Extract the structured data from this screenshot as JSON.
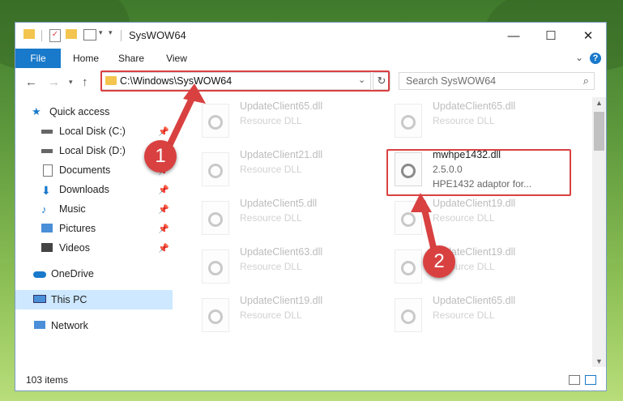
{
  "window": {
    "title": "SysWOW64"
  },
  "ribbon": {
    "tabs": [
      "File",
      "Home",
      "Share",
      "View"
    ]
  },
  "nav": {
    "address": "C:\\Windows\\SysWOW64",
    "search_placeholder": "Search SysWOW64"
  },
  "sidebar": {
    "items": [
      {
        "label": "Quick access",
        "icon": "star-icon"
      },
      {
        "label": "Local Disk (C:)",
        "icon": "drive-icon"
      },
      {
        "label": "Local Disk (D:)",
        "icon": "drive-icon"
      },
      {
        "label": "Documents",
        "icon": "documents-icon"
      },
      {
        "label": "Downloads",
        "icon": "download-icon"
      },
      {
        "label": "Music",
        "icon": "music-icon"
      },
      {
        "label": "Pictures",
        "icon": "pictures-icon"
      },
      {
        "label": "Videos",
        "icon": "video-icon"
      },
      {
        "label": "OneDrive",
        "icon": "cloud-icon"
      },
      {
        "label": "This PC",
        "icon": "computer-icon"
      },
      {
        "label": "Network",
        "icon": "network-icon"
      }
    ]
  },
  "files": [
    {
      "name": "UpdateClient65.dll",
      "type": "Resource DLL"
    },
    {
      "name": "UpdateClient65.dll",
      "type": "Resource DLL"
    },
    {
      "name": "UpdateClient21.dll",
      "type": "Resource DLL"
    },
    {
      "name": "mwhpe1432.dll",
      "type": "2.5.0.0",
      "desc": "HPE1432 adaptor for..."
    },
    {
      "name": "UpdateClient5.dll",
      "type": "Resource DLL"
    },
    {
      "name": "UpdateClient19.dll",
      "type": "Resource DLL"
    },
    {
      "name": "UpdateClient63.dll",
      "type": "Resource DLL"
    },
    {
      "name": "UpdateClient19.dll",
      "type": "Resource DLL"
    },
    {
      "name": "UpdateClient19.dll",
      "type": "Resource DLL"
    },
    {
      "name": "UpdateClient65.dll",
      "type": "Resource DLL"
    }
  ],
  "status": {
    "count": "103 items"
  },
  "annotations": {
    "step1": "1",
    "step2": "2"
  },
  "colors": {
    "accent": "#1979ca",
    "highlight": "#d94141",
    "selected": "#cde8ff"
  }
}
